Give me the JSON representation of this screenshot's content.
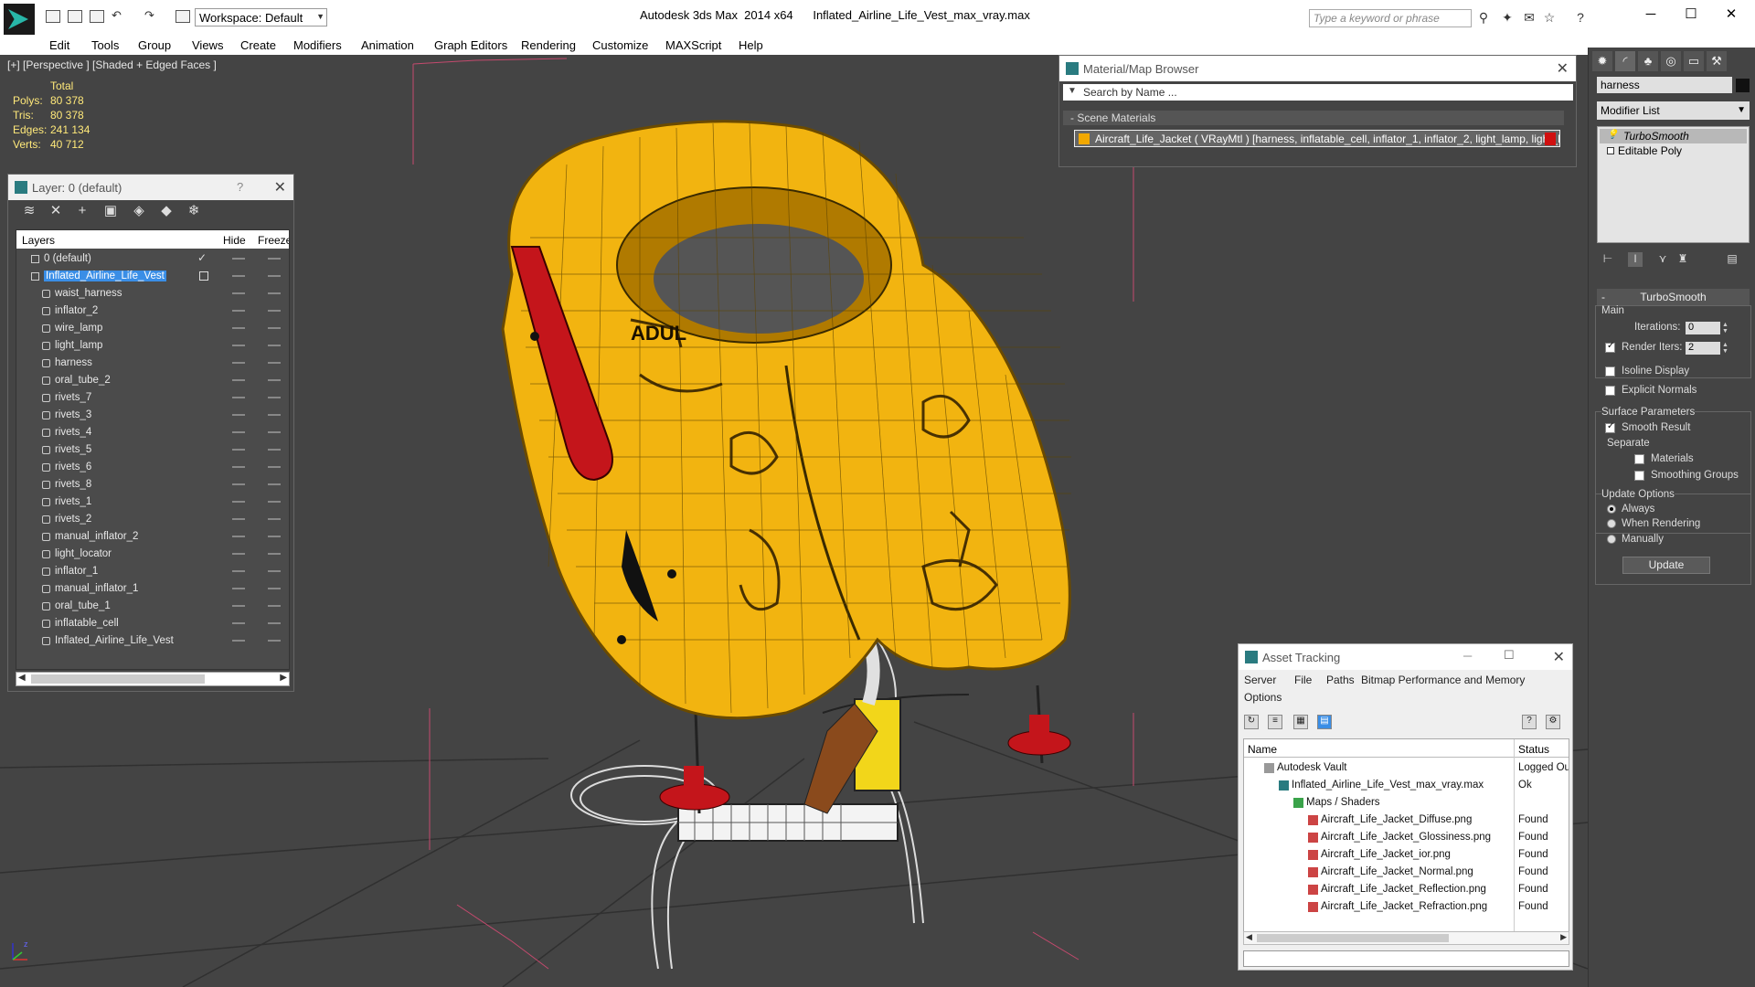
{
  "app": {
    "title": "Autodesk 3ds Max  2014 x64      Inflated_Airline_Life_Vest_max_vray.max",
    "workspace": "Workspace: Default",
    "search_placeholder": "Type a keyword or phrase"
  },
  "menu": [
    "Edit",
    "Tools",
    "Group",
    "Views",
    "Create",
    "Modifiers",
    "Animation",
    "Graph Editors",
    "Rendering",
    "Customize",
    "MAXScript",
    "Help"
  ],
  "viewport": {
    "label": "[+] [Perspective ] [Shaded + Edged Faces ]",
    "stats": {
      "total_label": "Total",
      "rows": [
        {
          "k": "Polys:",
          "v": "80 378"
        },
        {
          "k": "Tris:",
          "v": "80 378"
        },
        {
          "k": "Edges:",
          "v": "241 134"
        },
        {
          "k": "Verts:",
          "v": "40 712"
        }
      ]
    }
  },
  "layer_explorer": {
    "title": "Layer: 0 (default)",
    "help": "?",
    "col_layers": "Layers",
    "col_hide": "Hide",
    "col_freeze": "Freeze",
    "rows": [
      {
        "name": "0 (default)",
        "indent": 0,
        "type": "layer"
      },
      {
        "name": "Inflated_Airline_Life_Vest",
        "indent": 0,
        "type": "layer",
        "selected": true
      },
      {
        "name": "waist_harness",
        "indent": 1,
        "type": "obj"
      },
      {
        "name": "inflator_2",
        "indent": 1,
        "type": "obj"
      },
      {
        "name": "wire_lamp",
        "indent": 1,
        "type": "obj"
      },
      {
        "name": "light_lamp",
        "indent": 1,
        "type": "obj"
      },
      {
        "name": "harness",
        "indent": 1,
        "type": "obj"
      },
      {
        "name": "oral_tube_2",
        "indent": 1,
        "type": "obj"
      },
      {
        "name": "rivets_7",
        "indent": 1,
        "type": "obj"
      },
      {
        "name": "rivets_3",
        "indent": 1,
        "type": "obj"
      },
      {
        "name": "rivets_4",
        "indent": 1,
        "type": "obj"
      },
      {
        "name": "rivets_5",
        "indent": 1,
        "type": "obj"
      },
      {
        "name": "rivets_6",
        "indent": 1,
        "type": "obj"
      },
      {
        "name": "rivets_8",
        "indent": 1,
        "type": "obj"
      },
      {
        "name": "rivets_1",
        "indent": 1,
        "type": "obj"
      },
      {
        "name": "rivets_2",
        "indent": 1,
        "type": "obj"
      },
      {
        "name": "manual_inflator_2",
        "indent": 1,
        "type": "obj"
      },
      {
        "name": "light_locator",
        "indent": 1,
        "type": "obj"
      },
      {
        "name": "inflator_1",
        "indent": 1,
        "type": "obj"
      },
      {
        "name": "manual_inflator_1",
        "indent": 1,
        "type": "obj"
      },
      {
        "name": "oral_tube_1",
        "indent": 1,
        "type": "obj"
      },
      {
        "name": "inflatable_cell",
        "indent": 1,
        "type": "obj"
      },
      {
        "name": "Inflated_Airline_Life_Vest",
        "indent": 1,
        "type": "obj"
      }
    ]
  },
  "material_browser": {
    "title": "Material/Map Browser",
    "search": "Search by Name ...",
    "group": "- Scene Materials",
    "material": "Aircraft_Life_Jacket ( VRayMtl ) [harness, inflatable_cell, inflator_1, inflator_2, light_lamp, light_l..."
  },
  "command_panel": {
    "object_name": "harness",
    "modifier_list": "Modifier List",
    "stack": [
      "TurboSmooth",
      "Editable Poly"
    ],
    "rollout": "TurboSmooth",
    "main": "Main",
    "iterations_label": "Iterations:",
    "iterations": "0",
    "render_iters_label": "Render Iters:",
    "render_iters": "2",
    "render_iters_checked": true,
    "isoline": "Isoline Display",
    "explicit": "Explicit Normals",
    "surface_params": "Surface Parameters",
    "smooth_result": "Smooth Result",
    "separate": "Separate",
    "materials": "Materials",
    "smoothing_groups": "Smoothing Groups",
    "update_options": "Update Options",
    "always": "Always",
    "when_rendering": "When Rendering",
    "manually": "Manually",
    "update": "Update"
  },
  "asset_tracking": {
    "title": "Asset Tracking",
    "menu": [
      "Server",
      "File",
      "Paths",
      "Bitmap Performance and Memory",
      "Options"
    ],
    "col_name": "Name",
    "col_status": "Status",
    "rows": [
      {
        "name": "Autodesk Vault",
        "status": "Logged Ou",
        "indent": 0,
        "icon": "vault"
      },
      {
        "name": "Inflated_Airline_Life_Vest_max_vray.max",
        "status": "Ok",
        "indent": 1,
        "icon": "max"
      },
      {
        "name": "Maps / Shaders",
        "status": "",
        "indent": 2,
        "icon": "maps"
      },
      {
        "name": "Aircraft_Life_Jacket_Diffuse.png",
        "status": "Found",
        "indent": 3,
        "icon": "png"
      },
      {
        "name": "Aircraft_Life_Jacket_Glossiness.png",
        "status": "Found",
        "indent": 3,
        "icon": "png"
      },
      {
        "name": "Aircraft_Life_Jacket_ior.png",
        "status": "Found",
        "indent": 3,
        "icon": "png"
      },
      {
        "name": "Aircraft_Life_Jacket_Normal.png",
        "status": "Found",
        "indent": 3,
        "icon": "png"
      },
      {
        "name": "Aircraft_Life_Jacket_Reflection.png",
        "status": "Found",
        "indent": 3,
        "icon": "png"
      },
      {
        "name": "Aircraft_Life_Jacket_Refraction.png",
        "status": "Found",
        "indent": 3,
        "icon": "png"
      }
    ]
  },
  "colors": {
    "vest_yellow": "#f2b410",
    "vest_dark": "#b07a00",
    "select_blue": "#3a8ee6",
    "stat_yellow": "#ffe97a",
    "red_part": "#c4151b"
  }
}
